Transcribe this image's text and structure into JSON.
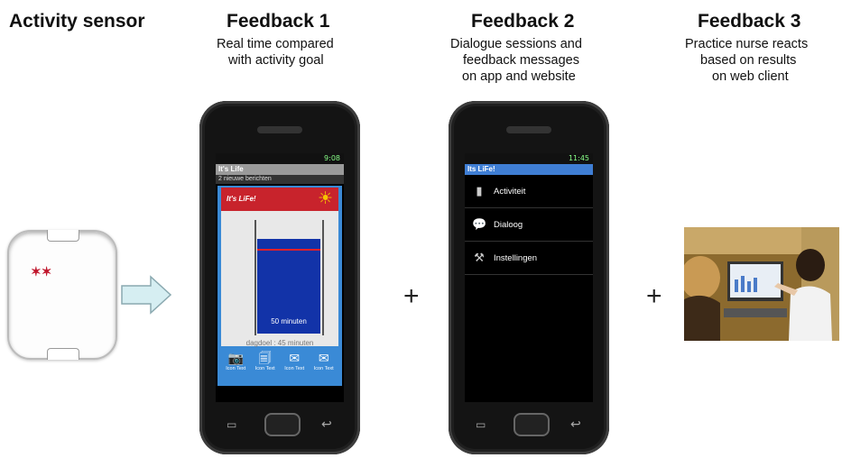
{
  "sensor_title": "Activity sensor",
  "feedback1": {
    "heading": "Feedback 1",
    "line1": "Real time compared",
    "line2": "with activity goal"
  },
  "feedback2": {
    "heading": "Feedback 2",
    "line1": "Dialogue sessions and",
    "line2": "feedback messages",
    "line3": "on app and website"
  },
  "feedback3": {
    "heading": "Feedback 3",
    "line1": "Practice nurse reacts",
    "line2": "based on results",
    "line3": "on web client"
  },
  "plus_sign": "+",
  "phone1": {
    "time": "9:08",
    "app_title": "It's Life",
    "notice": "2 nieuwe berichten",
    "brand": "It's LiFe!",
    "minutes_label": "50 minuten",
    "goal_label": "dagdoel : 45 minuten",
    "minutes": 50,
    "goal": 45,
    "icons": [
      {
        "name": "camera-icon",
        "glyph": "📷",
        "label": "Icon Text"
      },
      {
        "name": "document-icon",
        "glyph": "🗐",
        "label": "Icon Text"
      },
      {
        "name": "mail-icon",
        "glyph": "✉",
        "label": "Icon Text"
      },
      {
        "name": "mailbox-icon",
        "glyph": "✉",
        "label": "Icon Text"
      }
    ]
  },
  "phone2": {
    "time": "11:45",
    "app_title": "Its LiFe!",
    "menu": [
      {
        "label": "Activiteit",
        "icon": "bar-chart-icon"
      },
      {
        "label": "Dialoog",
        "icon": "chat-bubbles-icon"
      },
      {
        "label": "Instellingen",
        "icon": "tools-icon"
      }
    ]
  },
  "colors": {
    "app_blue": "#3a8ad6",
    "banner_red": "#c8232c",
    "bar_blue": "#1233a8",
    "goal_red": "#e0202a"
  }
}
